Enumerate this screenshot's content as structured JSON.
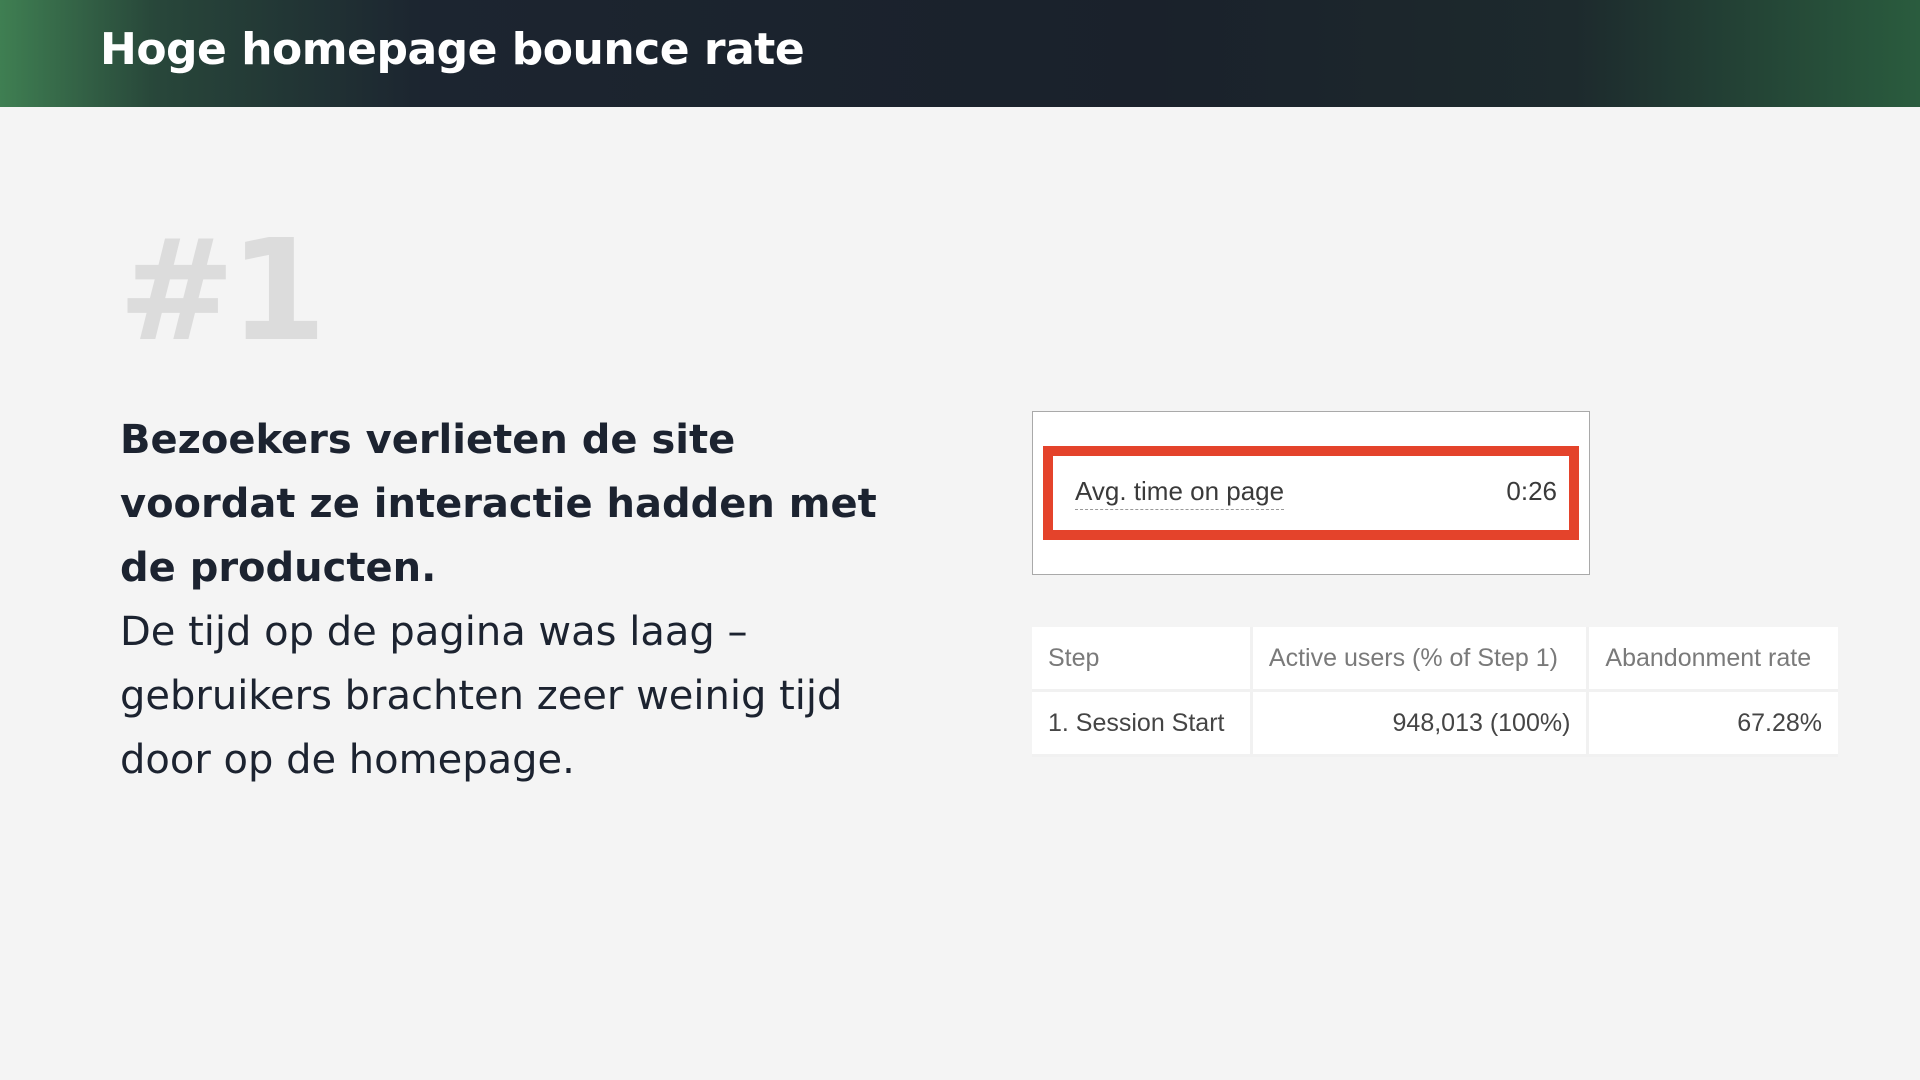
{
  "header": {
    "title": "Hoge homepage bounce rate"
  },
  "slide": {
    "number": "#1",
    "headline": "Bezoekers verlieten de site voordat ze interactie hadden met de producten.",
    "body": "De tijd op de pagina was laag – gebruikers brachten zeer weinig tijd door op de homepage."
  },
  "metric": {
    "label": "Avg. time on page",
    "value": "0:26",
    "highlight_color": "#e4432b"
  },
  "table": {
    "headers": [
      "Step",
      "Active users (% of Step 1)",
      "Abandonment rate"
    ],
    "rows": [
      [
        "1. Session Start",
        "948,013 (100%)",
        "67.28%"
      ]
    ]
  },
  "colors": {
    "header_dark": "#1a212b",
    "header_green": "#3f7f52",
    "background": "#f4f4f4",
    "text": "#1c2330",
    "number_gray": "#dcdcdc"
  }
}
